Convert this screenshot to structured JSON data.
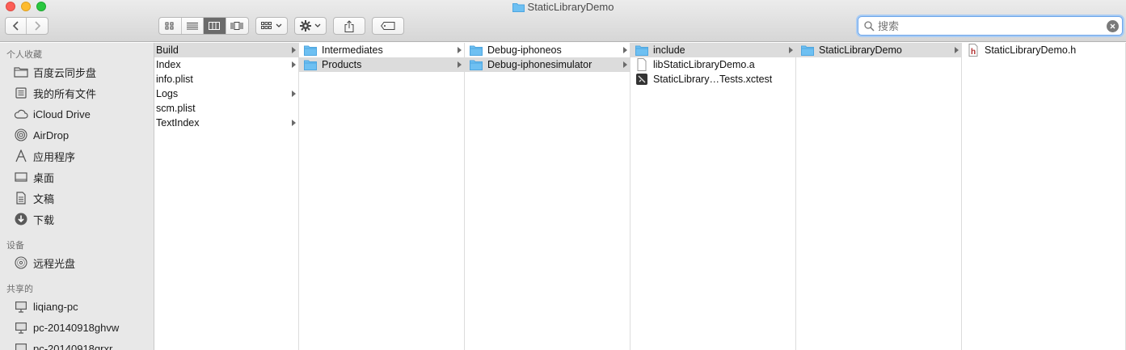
{
  "window": {
    "title": "StaticLibraryDemo"
  },
  "search": {
    "placeholder": "搜索"
  },
  "sidebar": {
    "favorites_header": "个人收藏",
    "favorites": [
      {
        "label": "百度云同步盘",
        "icon": "folder-icon"
      },
      {
        "label": "我的所有文件",
        "icon": "all-files-icon"
      },
      {
        "label": "iCloud Drive",
        "icon": "cloud-icon"
      },
      {
        "label": "AirDrop",
        "icon": "airdrop-icon"
      },
      {
        "label": "应用程序",
        "icon": "applications-icon"
      },
      {
        "label": "桌面",
        "icon": "desktop-icon"
      },
      {
        "label": "文稿",
        "icon": "documents-icon"
      },
      {
        "label": "下载",
        "icon": "downloads-icon"
      }
    ],
    "devices_header": "设备",
    "devices": [
      {
        "label": "远程光盘",
        "icon": "disc-icon"
      }
    ],
    "shared_header": "共享的",
    "shared": [
      {
        "label": "liqiang-pc",
        "icon": "computer-icon"
      },
      {
        "label": "pc-20140918ghvw",
        "icon": "computer-icon"
      },
      {
        "label": "pc-20140918qrxr",
        "icon": "computer-icon"
      }
    ]
  },
  "columns": [
    {
      "items": [
        {
          "label": "Build",
          "arrow": true,
          "selected": true,
          "kind": "none"
        },
        {
          "label": "Index",
          "arrow": true,
          "kind": "none"
        },
        {
          "label": "info.plist",
          "arrow": false,
          "kind": "none"
        },
        {
          "label": "Logs",
          "arrow": true,
          "kind": "none"
        },
        {
          "label": "scm.plist",
          "arrow": false,
          "kind": "none"
        },
        {
          "label": "TextIndex",
          "arrow": true,
          "kind": "none"
        }
      ]
    },
    {
      "items": [
        {
          "label": "Intermediates",
          "arrow": true,
          "kind": "folder"
        },
        {
          "label": "Products",
          "arrow": true,
          "selected": true,
          "kind": "folder"
        }
      ]
    },
    {
      "items": [
        {
          "label": "Debug-iphoneos",
          "arrow": true,
          "kind": "folder"
        },
        {
          "label": "Debug-iphonesimulator",
          "arrow": true,
          "selected": true,
          "kind": "folder"
        }
      ]
    },
    {
      "items": [
        {
          "label": "include",
          "arrow": true,
          "selected": true,
          "kind": "folder"
        },
        {
          "label": "libStaticLibraryDemo.a",
          "arrow": false,
          "kind": "file"
        },
        {
          "label": "StaticLibrary…Tests.xctest",
          "arrow": false,
          "kind": "xctest"
        }
      ]
    },
    {
      "items": [
        {
          "label": "StaticLibraryDemo",
          "arrow": true,
          "selected": true,
          "kind": "folder"
        }
      ]
    },
    {
      "items": [
        {
          "label": "StaticLibraryDemo.h",
          "arrow": false,
          "kind": "header"
        }
      ]
    }
  ],
  "colors": {
    "folder": "#6ec0f2",
    "folder_dark": "#4ea6e0",
    "selection": "#dcdcdc",
    "accent": "#6ea6ea"
  }
}
